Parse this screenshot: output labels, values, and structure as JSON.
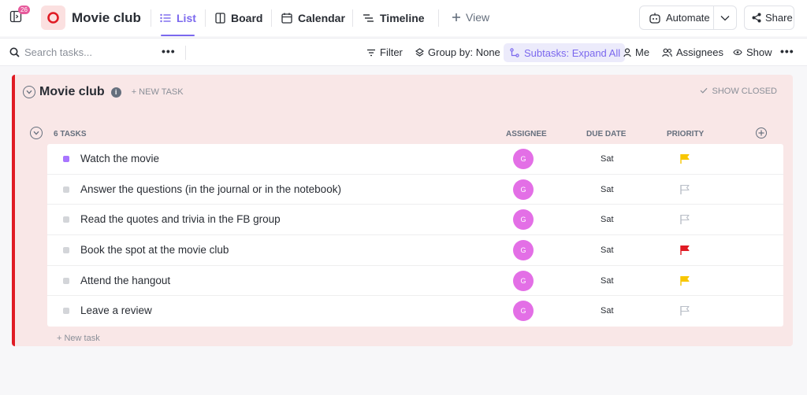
{
  "header": {
    "notification_count": "26",
    "space_title": "Movie club",
    "tabs": [
      {
        "label": "List",
        "icon": "list-icon",
        "active": true
      },
      {
        "label": "Board",
        "icon": "board-icon",
        "active": false
      },
      {
        "label": "Calendar",
        "icon": "calendar-icon",
        "active": false
      },
      {
        "label": "Timeline",
        "icon": "timeline-icon",
        "active": false
      }
    ],
    "add_view_label": "View",
    "automate_label": "Automate",
    "share_label": "Share",
    "accent_color": "#7b68ee"
  },
  "toolbar": {
    "search_placeholder": "Search tasks...",
    "filter_label": "Filter",
    "group_by_label": "Group by: None",
    "subtasks_label": "Subtasks: Expand All",
    "me_label": "Me",
    "assignees_label": "Assignees",
    "show_label": "Show"
  },
  "list": {
    "name": "Movie club",
    "info_glyph": "i",
    "new_task_label": "+ NEW TASK",
    "show_closed_label": "SHOW CLOSED",
    "task_count_label": "6 TASKS",
    "columns": {
      "assignee": "ASSIGNEE",
      "due_date": "DUE DATE",
      "priority": "PRIORITY"
    },
    "accent_color": "#e01b24",
    "tasks": [
      {
        "name": "Watch the movie",
        "status": "in-progress",
        "assignee_initial": "G",
        "due": "Sat",
        "priority": "high"
      },
      {
        "name": "Answer the questions (in the journal or in the notebook)",
        "status": "todo",
        "assignee_initial": "G",
        "due": "Sat",
        "priority": "none"
      },
      {
        "name": "Read the quotes and trivia in the FB group",
        "status": "todo",
        "assignee_initial": "G",
        "due": "Sat",
        "priority": "none"
      },
      {
        "name": "Book the spot at the movie club",
        "status": "todo",
        "assignee_initial": "G",
        "due": "Sat",
        "priority": "urgent"
      },
      {
        "name": "Attend the hangout",
        "status": "todo",
        "assignee_initial": "G",
        "due": "Sat",
        "priority": "high"
      },
      {
        "name": "Leave a review",
        "status": "todo",
        "assignee_initial": "G",
        "due": "Sat",
        "priority": "none"
      }
    ],
    "new_task_bottom_label": "+ New task"
  },
  "priority_colors": {
    "urgent": "#e01b24",
    "high": "#f8c600",
    "none": "#b9bec7"
  }
}
